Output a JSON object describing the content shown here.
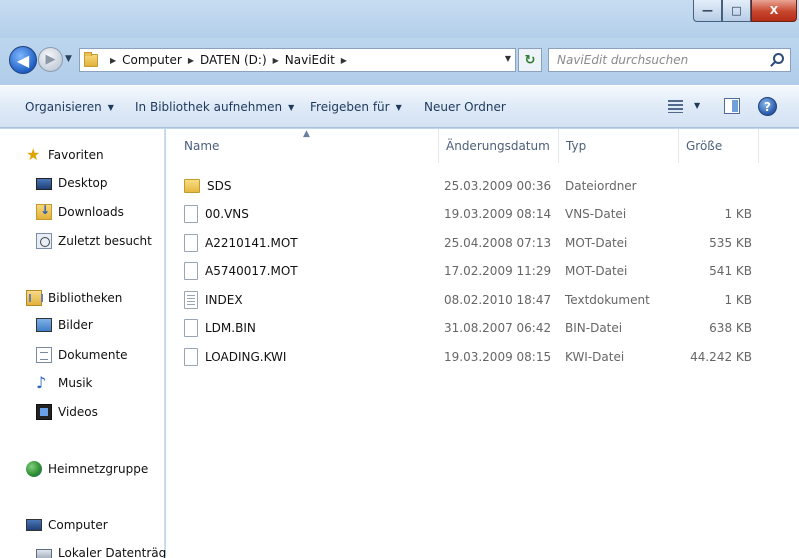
{
  "window": {
    "minimize_glyph": "—",
    "maximize_glyph": "□",
    "close_glyph": "X"
  },
  "address_bar": {
    "back_glyph": "◀",
    "forward_glyph": "▶",
    "history_glyph": "▼",
    "breadcrumbs": [
      "Computer",
      "DATEN (D:)",
      "NaviEdit"
    ],
    "crumb_separator": "▶",
    "dropdown_glyph": "▼",
    "refresh_glyph": "↻",
    "search_placeholder": "NaviEdit durchsuchen"
  },
  "toolbar": {
    "organize_label": "Organisieren",
    "include_library_label": "In Bibliothek aufnehmen",
    "share_label": "Freigeben für",
    "new_folder_label": "Neuer Ordner",
    "caret_glyph": "▼",
    "help_glyph": "?"
  },
  "nav_pane": {
    "favorites": "Favoriten",
    "desktop": "Desktop",
    "downloads": "Downloads",
    "recent": "Zuletzt besucht",
    "libraries": "Bibliotheken",
    "pictures": "Bilder",
    "documents": "Dokumente",
    "music": "Musik",
    "videos": "Videos",
    "homegroup": "Heimnetzgruppe",
    "computer": "Computer",
    "local_disk": "Lokaler Datenträger",
    "star_glyph": "★",
    "note_glyph": "♪"
  },
  "columns": {
    "name": "Name",
    "date": "Änderungsdatum",
    "type": "Typ",
    "size": "Größe",
    "sort_glyph": "▲"
  },
  "files": [
    {
      "name": "SDS",
      "date": "25.03.2009 00:36",
      "type": "Dateiordner",
      "size": "",
      "icon": "folder-icon"
    },
    {
      "name": "00.VNS",
      "date": "19.03.2009 08:14",
      "type": "VNS-Datei",
      "size": "1 KB",
      "icon": "file-icon"
    },
    {
      "name": "A2210141.MOT",
      "date": "25.04.2008 07:13",
      "type": "MOT-Datei",
      "size": "535 KB",
      "icon": "file-icon"
    },
    {
      "name": "A5740017.MOT",
      "date": "17.02.2009 11:29",
      "type": "MOT-Datei",
      "size": "541 KB",
      "icon": "file-icon"
    },
    {
      "name": "INDEX",
      "date": "08.02.2010 18:47",
      "type": "Textdokument",
      "size": "1 KB",
      "icon": "text-file-icon"
    },
    {
      "name": "LDM.BIN",
      "date": "31.08.2007 06:42",
      "type": "BIN-Datei",
      "size": "638 KB",
      "icon": "file-icon"
    },
    {
      "name": "LOADING.KWI",
      "date": "19.03.2009 08:15",
      "type": "KWI-Datei",
      "size": "44.242 KB",
      "icon": "file-icon"
    }
  ]
}
